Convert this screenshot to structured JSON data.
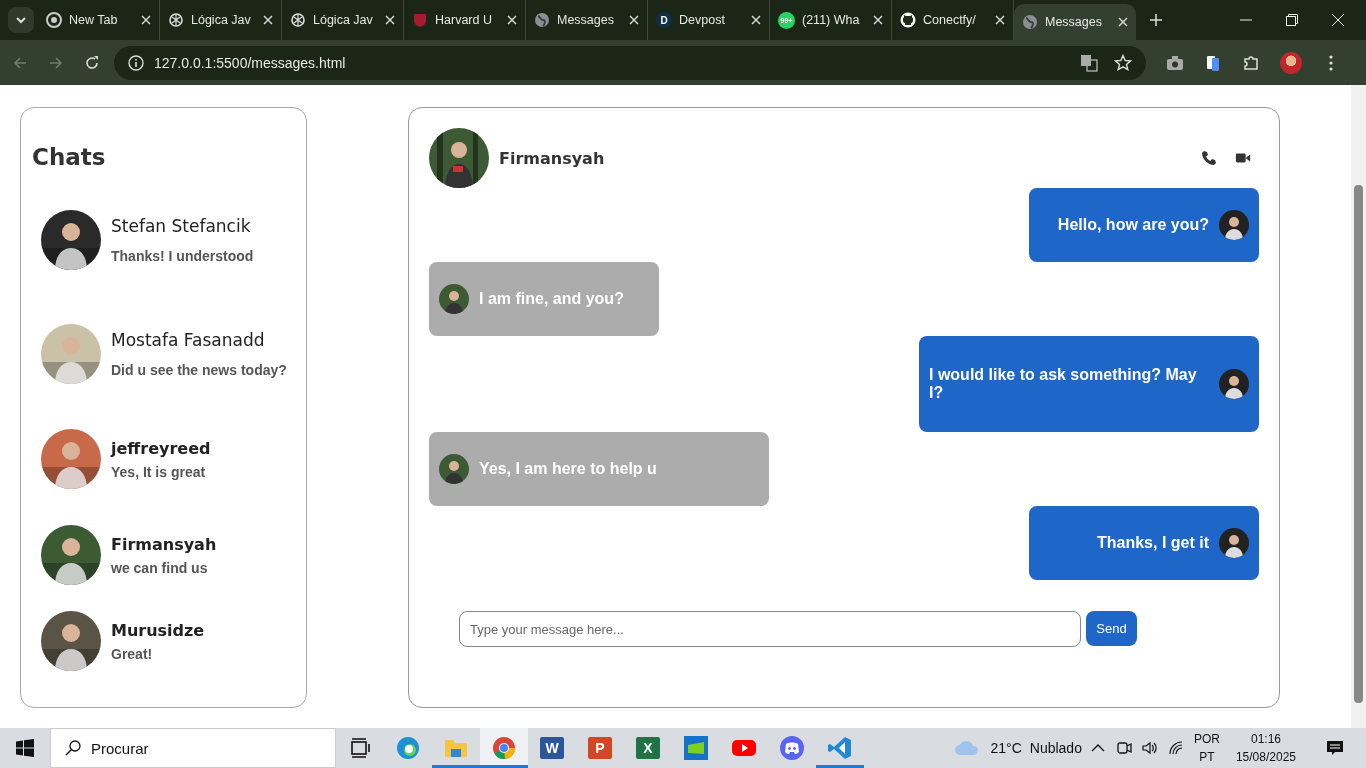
{
  "browser": {
    "tabs": [
      {
        "label": "New Tab",
        "selected": false
      },
      {
        "label": "Lógica Jav",
        "selected": false
      },
      {
        "label": "Lógica Jav",
        "selected": false
      },
      {
        "label": "Harvard U",
        "selected": false
      },
      {
        "label": "Messages",
        "selected": false
      },
      {
        "label": "Devpost",
        "selected": false
      },
      {
        "label": "(211) Wha",
        "selected": false
      },
      {
        "label": "Conectfy/",
        "selected": false
      },
      {
        "label": "Messages",
        "selected": true
      }
    ],
    "devpost_letter": "D",
    "whatsapp_badge": "99+",
    "address": "127.0.0.1:5500/messages.html"
  },
  "chats": {
    "title": "Chats",
    "items": [
      {
        "name": "Stefan Stefancik",
        "preview": "Thanks! I understood"
      },
      {
        "name": "Mostafa Fasanadd",
        "preview": "Did u see the news today?"
      },
      {
        "name": "jeffreyreed",
        "preview": "Yes, It is great"
      },
      {
        "name": "Firmansyah",
        "preview": "we can find us"
      },
      {
        "name": "Murusidze",
        "preview": "Great!"
      }
    ]
  },
  "conversation": {
    "name": "Firmansyah",
    "messages": [
      {
        "kind": "sent",
        "text": "Hello, how are you?"
      },
      {
        "kind": "received",
        "text": "I am fine, and you?"
      },
      {
        "kind": "sent",
        "text": "I would like to ask something? May I?"
      },
      {
        "kind": "received",
        "text": "Yes, I am here to help u"
      },
      {
        "kind": "sent",
        "text": "Thanks, I get it"
      }
    ],
    "input": {
      "placeholder": "Type your message here..."
    },
    "send": "Send"
  },
  "taskbar": {
    "search": "Procurar",
    "apps": [
      {
        "kind": "taskview",
        "open": false,
        "selected": false
      },
      {
        "kind": "edge",
        "open": false,
        "selected": false
      },
      {
        "kind": "explorer",
        "open": true,
        "selected": false
      },
      {
        "kind": "chrome",
        "open": true,
        "selected": true
      },
      {
        "kind": "word",
        "letter": "W",
        "open": false,
        "selected": false
      },
      {
        "kind": "powerpoint",
        "letter": "P",
        "open": false,
        "selected": false
      },
      {
        "kind": "excel",
        "letter": "X",
        "open": false,
        "selected": false
      },
      {
        "kind": "green",
        "open": false,
        "selected": false
      },
      {
        "kind": "youtube",
        "open": false,
        "selected": false
      },
      {
        "kind": "discord",
        "open": false,
        "selected": false
      },
      {
        "kind": "vscode",
        "open": true,
        "selected": false
      }
    ],
    "weather": {
      "temp": "21°C",
      "condition": "Nublado"
    },
    "language": [
      "POR",
      "PT"
    ],
    "time": "01:16",
    "date": "15/08/2025"
  }
}
